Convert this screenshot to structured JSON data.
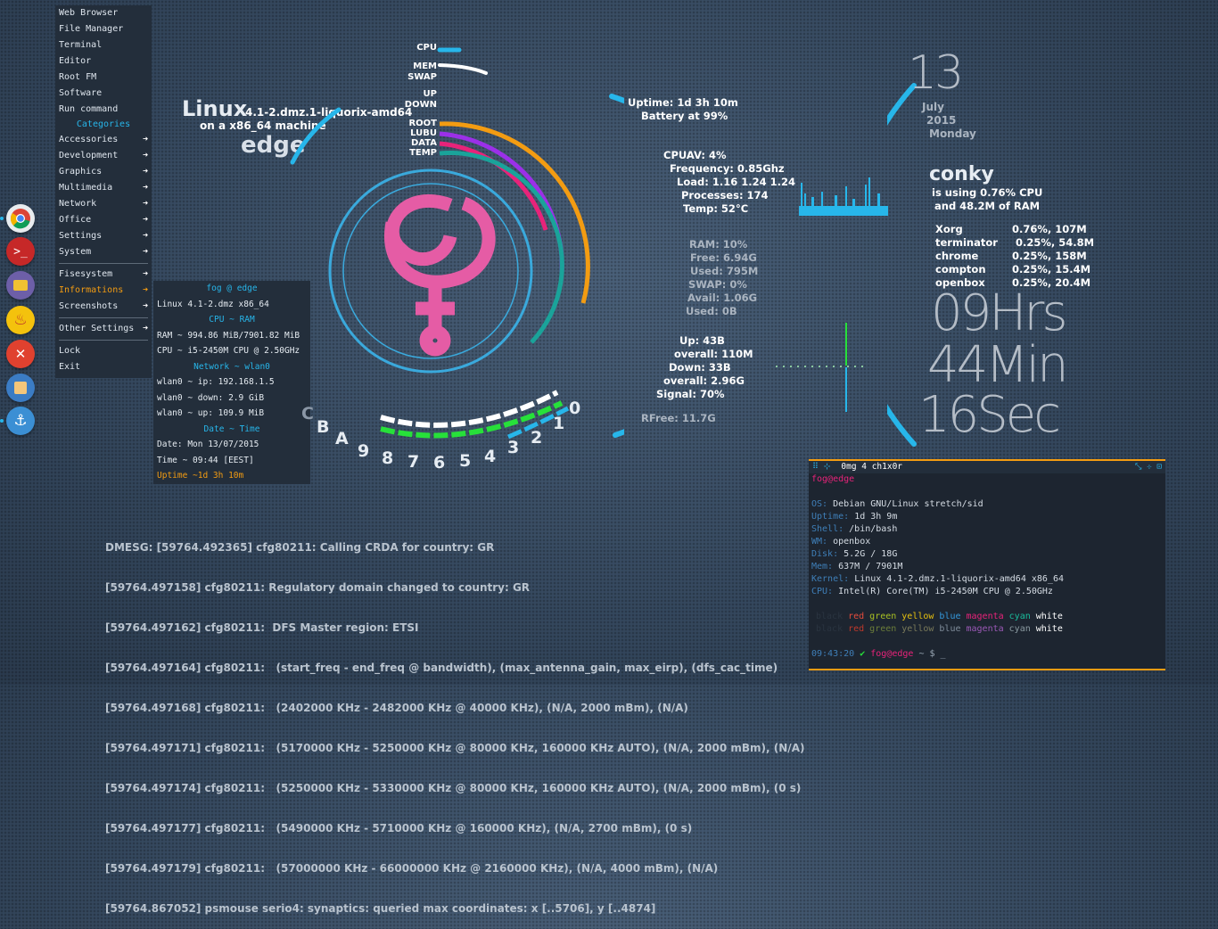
{
  "menu": {
    "items_top": [
      "Web Browser",
      "File Manager",
      "Terminal",
      "Editor",
      "Root FM",
      "Software",
      "Run command"
    ],
    "categories_header": "Categories",
    "categories": [
      "Accessories",
      "Development",
      "Graphics",
      "Multimedia",
      "Network",
      "Office",
      "Settings",
      "System"
    ],
    "items_mid": [
      "Fisesystem",
      "Informations",
      "Screenshots"
    ],
    "other_settings": "Other Settings",
    "lock": "Lock",
    "exit": "Exit"
  },
  "info_menu": {
    "host": "fog @ edge",
    "kernel": "Linux 4.1-2.dmz x86_64",
    "cpu_ram_header": "CPU ~ RAM",
    "ram": "RAM ~ 994.86 MiB/7901.82 MiB",
    "cpu": "CPU ~ i5-2450M CPU @ 2.50GHz",
    "network_header": "Network ~ wlan0",
    "ip": "wlan0 ~   ip: 192.168.1.5",
    "down": "wlan0 ~ down: 2.9 GiB",
    "up": "wlan0 ~   up: 109.9 MiB",
    "date_header": "Date ~ Time",
    "date": "Date: Mon 13/07/2015",
    "time": "Time ~ 09:44 [EEST]",
    "uptime": "Uptime ~1d 3h 10m"
  },
  "dock_icons": [
    "chrome-icon",
    "terminal-app-icon",
    "archive-manager-icon",
    "genie-lamp-icon",
    "close-app-icon",
    "package-icon",
    "anchor-icon"
  ],
  "conky_left": {
    "os": "Linux",
    "kernel": "4.1-2.dmz.1-liquorix-amd64",
    "machine": "on a x86_64 machine",
    "hostname": "edge",
    "ring_labels": [
      "CPU",
      "MEM",
      "SWAP",
      "UP",
      "DOWN",
      "ROOT",
      "LUBU",
      "DATA",
      "TEMP"
    ],
    "clock_labels": [
      "C",
      "B",
      "A",
      "9",
      "8",
      "7",
      "6",
      "5",
      "4",
      "3",
      "2",
      "1",
      "0"
    ]
  },
  "conky_mid": {
    "uptime": "Uptime: 1d 3h 10m",
    "battery": "Battery at 99%",
    "cpuav": "CPUAV: 4%",
    "frequency": "Frequency: 0.85Ghz",
    "load": "Load: 1.16 1.24 1.24",
    "processes": "Processes: 174",
    "temp": "Temp: 52°C",
    "ram": "RAM: 10%",
    "free": "Free: 6.94G",
    "used": "Used: 795M",
    "swap": "SWAP: 0%",
    "avail": "Avail: 1.06G",
    "swap_used": "Used: 0B",
    "up": "Up: 43B",
    "up_overall": "overall: 110M",
    "down": "Down: 33B",
    "down_overall": "overall: 2.96G",
    "signal": "Signal: 70%",
    "rfree": "RFree: 11.7G"
  },
  "conky_right": {
    "day": "13",
    "month": "July",
    "year": "2015",
    "weekday": "Monday",
    "title": "conky",
    "cpu_use": "is using  0.76% CPU",
    "ram_use": "and 48.2M of RAM",
    "processes": [
      {
        "name": "Xorg",
        "val": "0.76%, 107M"
      },
      {
        "name": "terminator",
        "val": "0.25%, 54.8M"
      },
      {
        "name": "chrome",
        "val": "0.25%, 158M"
      },
      {
        "name": "compton",
        "val": "0.25%, 15.4M"
      },
      {
        "name": "openbox",
        "val": "0.25%, 20.4M"
      }
    ],
    "hours": "09Hrs",
    "minutes": "44Min",
    "seconds": "16Sec"
  },
  "dmesg": [
    "DMESG: [59764.492365] cfg80211: Calling CRDA for country: GR",
    "[59764.497158] cfg80211: Regulatory domain changed to country: GR",
    "[59764.497162] cfg80211:  DFS Master region: ETSI",
    "[59764.497164] cfg80211:   (start_freq - end_freq @ bandwidth), (max_antenna_gain, max_eirp), (dfs_cac_time)",
    "[59764.497168] cfg80211:   (2402000 KHz - 2482000 KHz @ 40000 KHz), (N/A, 2000 mBm), (N/A)",
    "[59764.497171] cfg80211:   (5170000 KHz - 5250000 KHz @ 80000 KHz, 160000 KHz AUTO), (N/A, 2000 mBm), (N/A)",
    "[59764.497174] cfg80211:   (5250000 KHz - 5330000 KHz @ 80000 KHz, 160000 KHz AUTO), (N/A, 2000 mBm), (0 s)",
    "[59764.497177] cfg80211:   (5490000 KHz - 5710000 KHz @ 160000 KHz), (N/A, 2700 mBm), (0 s)",
    "[59764.497179] cfg80211:   (57000000 KHz - 66000000 KHz @ 2160000 KHz), (N/A, 4000 mBm), (N/A)",
    "[59764.867052] psmouse serio4: synaptics: queried max coordinates: x [..5706], y [..4874]"
  ],
  "terminal": {
    "title": "0mg 4 ch1x0r",
    "prompt_user": "fog@edge",
    "os_label": "OS:",
    "os": "Debian GNU/Linux stretch/sid",
    "uptime_label": "Uptime:",
    "uptime": "1d 3h 9m",
    "shell_label": "Shell:",
    "shell": "/bin/bash",
    "wm_label": "WM:",
    "wm": "openbox",
    "disk_label": "Disk:",
    "disk": "5.2G / 18G",
    "mem_label": "Mem:",
    "mem": "637M / 7901M",
    "kernel_label": "Kernel:",
    "kernel": "Linux 4.1-2.dmz.1-liquorix-amd64 x86_64",
    "cpu_label": "CPU:",
    "cpu": "Intel(R) Core(TM) i5-2450M CPU @ 2.50GHz",
    "colors": [
      "black",
      "red",
      "green",
      "yellow",
      "blue",
      "magenta",
      "cyan",
      "white"
    ],
    "prompt_time": "09:43:20",
    "prompt_check": "✔",
    "prompt_host": "fog@edge",
    "prompt_tail": "~ $ _"
  },
  "accent_colors": {
    "cyan": "#27b6ea",
    "orange": "#f39c12",
    "purple": "#9b30e8",
    "magenta": "#e8237a",
    "teal": "#1aa39a",
    "pink": "#e55ca5",
    "green": "#27e03a"
  }
}
